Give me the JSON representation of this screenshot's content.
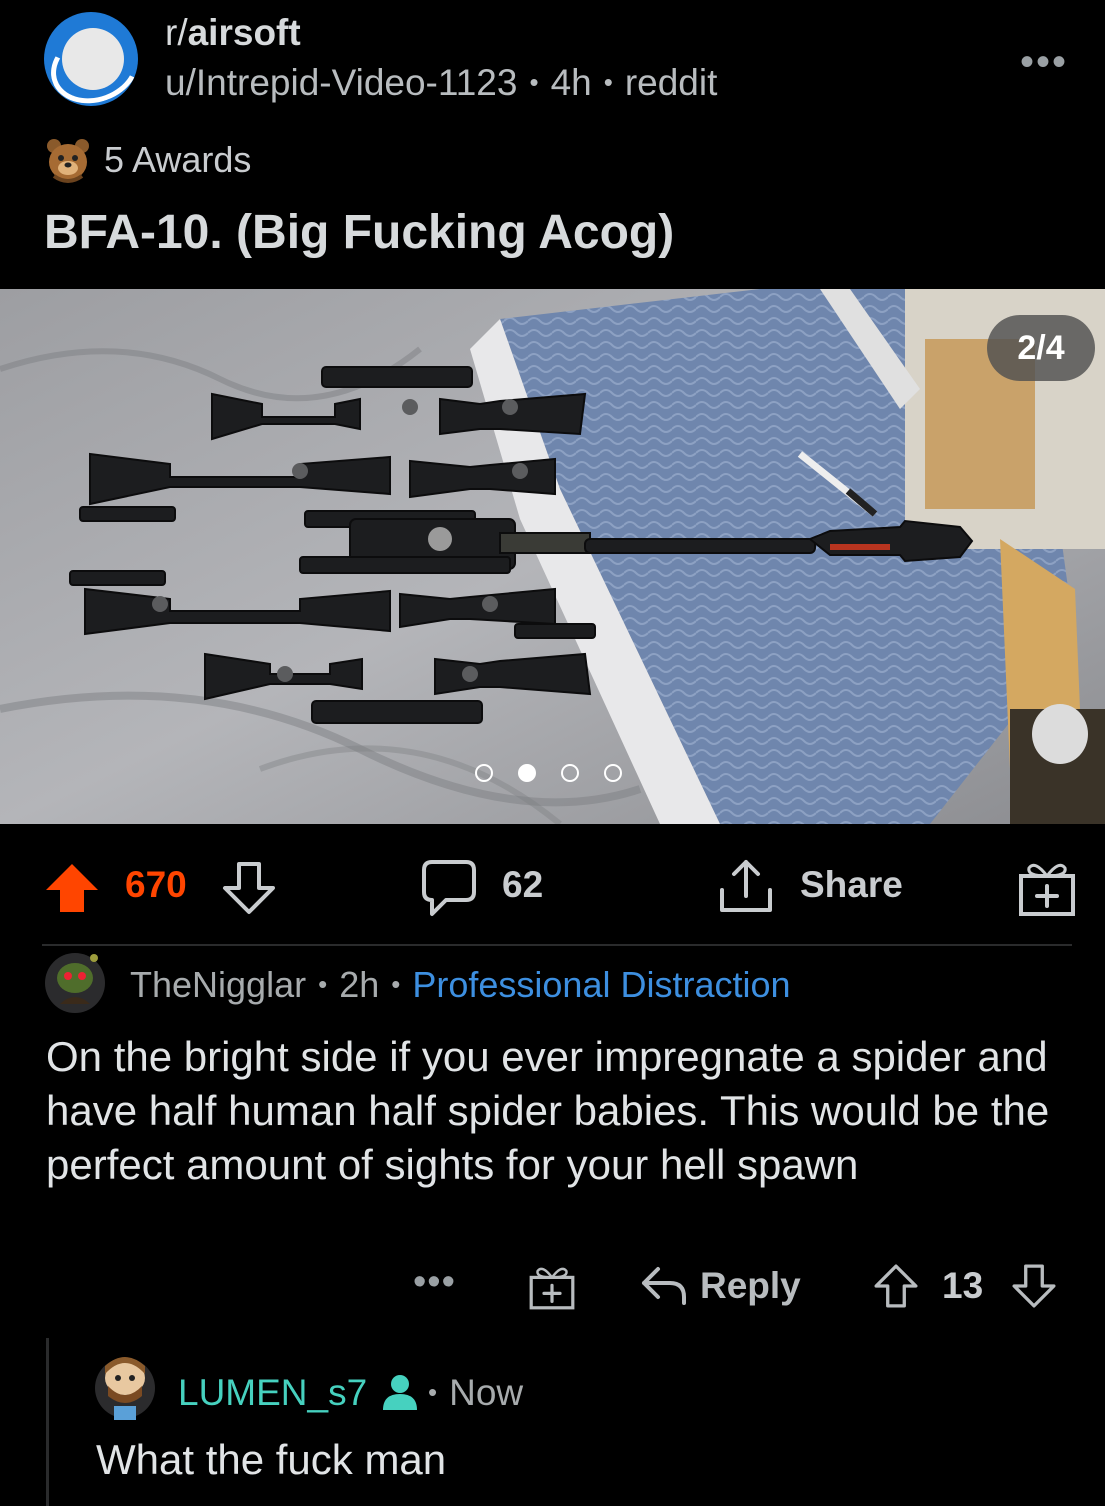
{
  "post": {
    "subreddit_prefix": "r/",
    "subreddit_name": "airsoft",
    "author": "u/Intrepid-Video-1123",
    "age": "4h",
    "domain": "reddit",
    "awards": "5 Awards",
    "title": "BFA-10. (Big Fucking Acog)",
    "gallery_position": "2/4",
    "gallery_total": 4,
    "gallery_active_index": 2,
    "score": "670",
    "comment_count": "62",
    "share_label": "Share"
  },
  "comments": [
    {
      "author": "TheNigglar",
      "age": "2h",
      "flair": "Professional Distraction",
      "body": "On the bright side if you ever impregnate a spider and have half human half spider babies. This would be the perfect amount of sights for your hell spawn",
      "reply_label": "Reply",
      "score": "13"
    },
    {
      "author": "LUMEN_s7",
      "age": "Now",
      "body": "What the fuck man"
    }
  ],
  "icons": {
    "more": "more-horizontal-icon",
    "award": "bear-award-icon",
    "upvote": "upvote-arrow-icon",
    "downvote": "downvote-arrow-icon",
    "comment": "comment-bubble-icon",
    "share": "share-upload-icon",
    "give_award": "gift-award-icon",
    "reply": "reply-arrow-icon",
    "op": "person-icon"
  },
  "colors": {
    "background": "#000000",
    "upvote_active": "#ff4500",
    "flair": "#3d8fe0",
    "username_teal": "#46d1bf",
    "subreddit_avatar": "#1f7ad6"
  }
}
